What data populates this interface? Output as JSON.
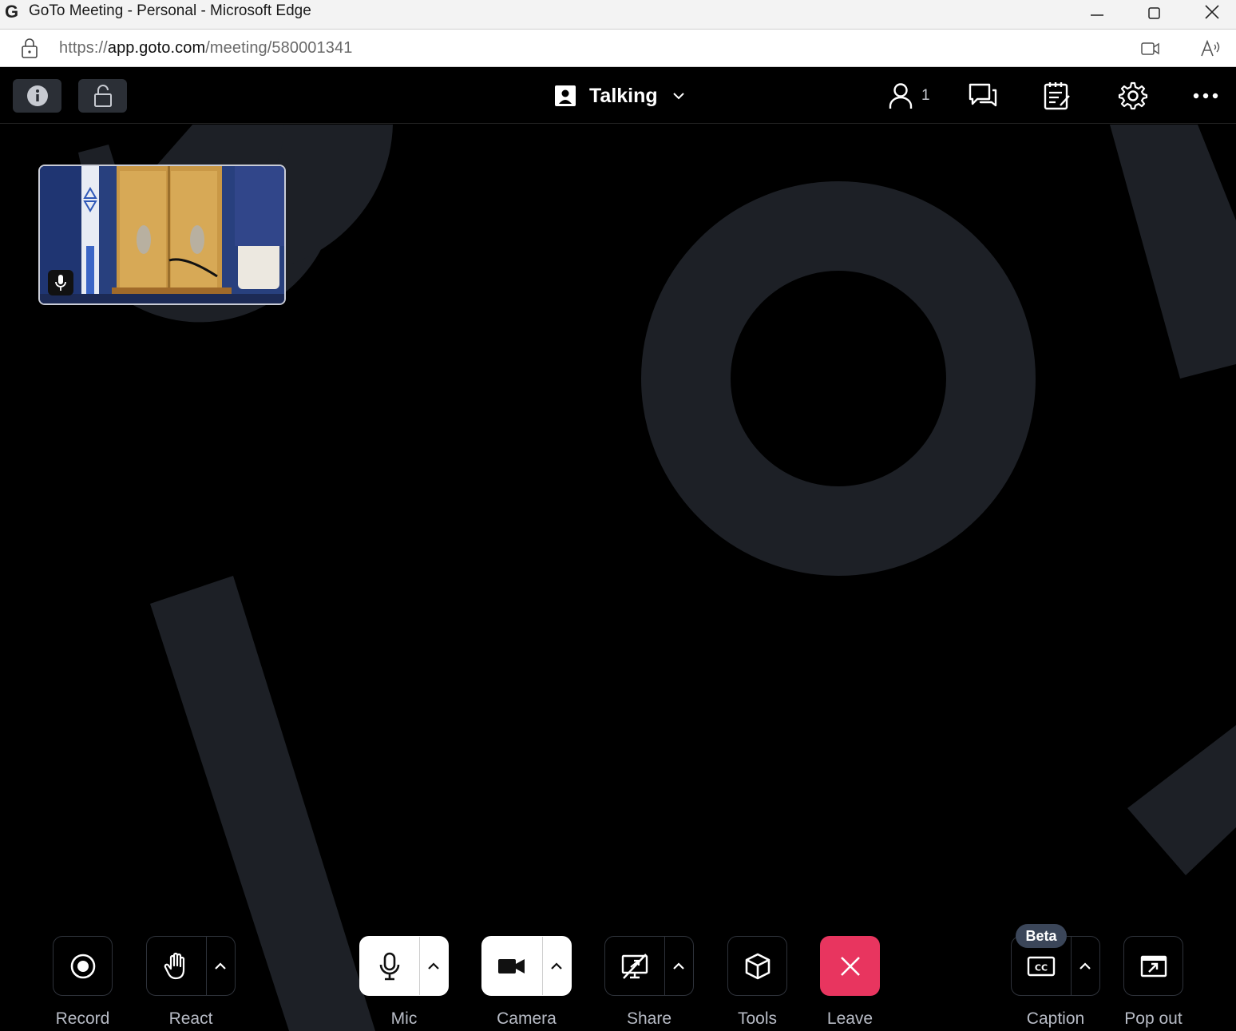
{
  "window": {
    "title": "GoTo Meeting - Personal - Microsoft Edge",
    "logo_letter": "G"
  },
  "address": {
    "url_prefix": "https://",
    "url_host": "app.goto.com",
    "url_path": "/meeting/580001341"
  },
  "topbar": {
    "view_mode": "Talking",
    "attendee_count": "1"
  },
  "controls": {
    "record": "Record",
    "react": "React",
    "mic": "Mic",
    "camera": "Camera",
    "share": "Share",
    "tools": "Tools",
    "leave": "Leave",
    "caption": "Caption",
    "caption_badge": "Beta",
    "popout": "Pop out"
  },
  "colors": {
    "leave": "#e8355f",
    "background_shape": "#1d2026",
    "button_border": "#2e323a"
  }
}
